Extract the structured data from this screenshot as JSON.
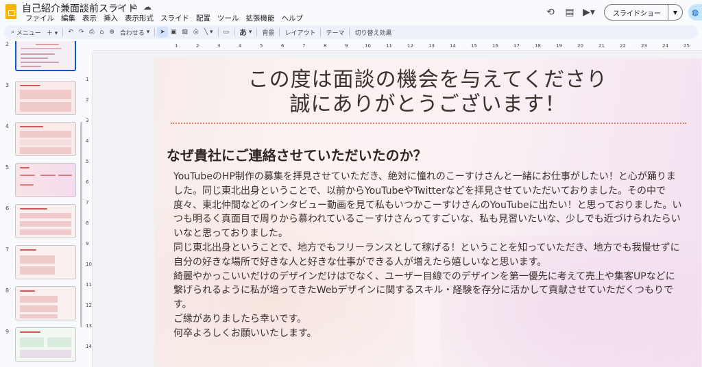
{
  "app": {
    "doc_title": "自己紹介兼面談前スライド",
    "menu": [
      "ファイル",
      "編集",
      "表示",
      "挿入",
      "表示形式",
      "スライド",
      "配置",
      "ツール",
      "拡張機能",
      "ヘルプ"
    ],
    "slideshow_label": "スライドショー"
  },
  "toolbar": {
    "search_label": "メニュー",
    "zoom_label": "合わせる",
    "background_label": "背景",
    "layout_label": "レイアウト",
    "theme_label": "テーマ",
    "transition_label": "切り替え効果",
    "text_label": "あ"
  },
  "filmstrip": {
    "slides": [
      {
        "num": "2",
        "active": true
      },
      {
        "num": "3",
        "active": false
      },
      {
        "num": "4",
        "active": false
      },
      {
        "num": "5",
        "active": false
      },
      {
        "num": "6",
        "active": false
      },
      {
        "num": "7",
        "active": false
      },
      {
        "num": "8",
        "active": false
      },
      {
        "num": "9",
        "active": false
      }
    ]
  },
  "rulers": {
    "h": [
      "1",
      "2",
      "3",
      "4",
      "5",
      "6",
      "7",
      "8",
      "9",
      "10",
      "11",
      "12",
      "13",
      "14",
      "15",
      "16",
      "17",
      "18",
      "19",
      "20",
      "21",
      "22",
      "23",
      "24",
      "25"
    ],
    "v": [
      "1",
      "2",
      "3",
      "4",
      "5",
      "6",
      "7",
      "8",
      "9",
      "10",
      "11",
      "12",
      "13",
      "14"
    ]
  },
  "slide": {
    "title_line1": "この度は面談の機会を与えてくださり",
    "title_line2": "誠にありがとうございます！",
    "heading": "なぜ貴社にご連絡させていただいたのか？",
    "body": [
      "YouTubeのHP制作の募集を拝見させていただき、絶対に憧れのこーすけさんと一緒にお仕事がしたい！と心が踊りました。同じ東北出身ということで、以前からYouTubeやTwitterなどを拝見させていただいておりました。その中で度々、東北仲間などのインタビュー動画を見て私もいつかこーすけさんのYouTubeに出たい！と思っておりました。いつも明るく真面目で周りから慕われているこーすけさんってすごいな、私も見習いたいな、少しでも近づけられたらいいなと思っておりました。",
      "同じ東北出身ということで、地方でもフリーランスとして稼げる！ということを知っていただき、地方でも我慢せずに自分の好きな場所で好きな人と好きな仕事ができる人が増えたら嬉しいなと思います。",
      "綺麗やかっこいいだけのデザインだけはでなく、ユーザー目線でのデザインを第一優先に考えて売上や集客UPなどに繋げられるように私が培ってきたWebデザインに関するスキル・経験を存分に活かして貢献させていただくつもりです。",
      "ご縁がありましたら幸いです。",
      "何卒よろしくお願いいたします。"
    ]
  }
}
